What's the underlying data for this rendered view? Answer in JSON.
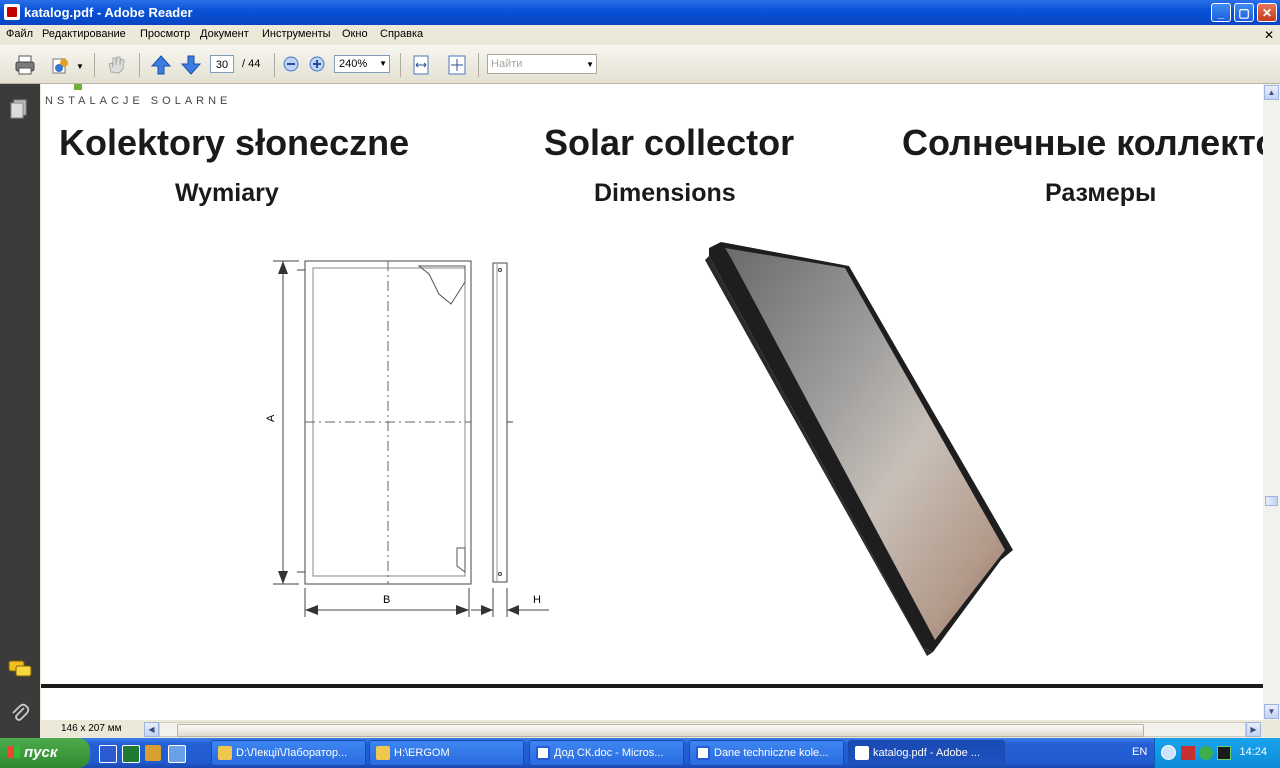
{
  "window": {
    "title": "katalog.pdf - Adobe Reader"
  },
  "menu": [
    "Файл",
    "Редактирование",
    "Просмотр",
    "Документ",
    "Инструменты",
    "Окно",
    "Справка"
  ],
  "toolbar": {
    "page_current": "30",
    "page_total": "/ 44",
    "zoom": "240%",
    "find_placeholder": "Найти"
  },
  "document": {
    "logo_text": "NSTALACJE SOLARNE",
    "headings": [
      "Kolektory słoneczne",
      "Solar collector",
      "Солнечные коллектор"
    ],
    "subheadings": [
      "Wymiary",
      "Dimensions",
      "Размеры"
    ],
    "diagram_labels": {
      "a": "A",
      "b": "B",
      "h": "H"
    }
  },
  "status": {
    "page_size": "146 x 207 мм"
  },
  "taskbar": {
    "start_label": "пуск",
    "tasks": [
      "D:\\Лекції\\Лаборатор...",
      "H:\\ERGOM",
      "Дод СК.doc - Micros...",
      "Dane techniczne kole...",
      "katalog.pdf - Adobe ..."
    ],
    "lang": "EN",
    "clock": "14:24"
  }
}
